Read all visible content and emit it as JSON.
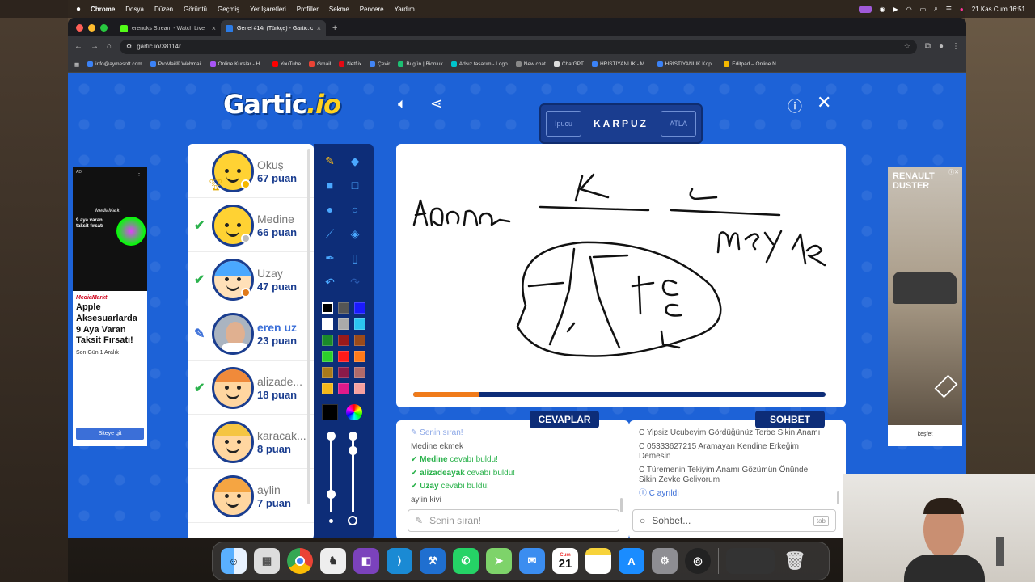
{
  "menubar": {
    "app": "Chrome",
    "items": [
      "Dosya",
      "Düzen",
      "Görüntü",
      "Geçmiş",
      "Yer İşaretleri",
      "Profiller",
      "Sekme",
      "Pencere",
      "Yardım"
    ],
    "clock": "21 Kas Cum  16:51"
  },
  "browser": {
    "tabs": [
      {
        "title": "erenuks Stream - Watch Live",
        "color": "#53fc18"
      },
      {
        "title": "Genel #14r (Türkçe) - Gartic.io",
        "color": "#2c7be5"
      }
    ],
    "url": "gartic.io/38114r",
    "bookmarks": [
      "info@aymesoft.com",
      "ProMail® Webmail",
      "Online Kurslar - H...",
      "YouTube",
      "Gmail",
      "Netflix",
      "Çevir",
      "Bugün | Bionluk",
      "Adsız tasarım - Logo",
      "New chat",
      "ChatGPT",
      "HRİSTİYANLIK - M...",
      "HRİSTİYANLIK Kop...",
      "Editpad – Online N..."
    ]
  },
  "game": {
    "logo_main": "Gartic",
    "logo_io": ".io",
    "hint_button": "İpucu",
    "word": "KARPUZ",
    "skip_button": "ATLA",
    "timer_fraction": 0.16,
    "players": [
      {
        "name": "Okuş",
        "score": "67 puan",
        "mark": "",
        "avatar_color": "#ffd233",
        "badge": "#f5b800"
      },
      {
        "name": "Medine",
        "score": "66 puan",
        "mark": "check",
        "avatar_color": "#ffd233",
        "badge": "#bbbbbb"
      },
      {
        "name": "Uzay",
        "score": "47 puan",
        "mark": "check",
        "avatar_color": "#4aa8ff",
        "badge": "#e07a1a"
      },
      {
        "name": "eren uz",
        "score": "23 puan",
        "mark": "pencil",
        "avatar_color": "#8899aa",
        "badge": ""
      },
      {
        "name": "alizade...",
        "score": "18 puan",
        "mark": "check",
        "avatar_color": "#f08a3a",
        "badge": ""
      },
      {
        "name": "karacak...",
        "score": "8 puan",
        "mark": "",
        "avatar_color": "#f5c542",
        "badge": ""
      },
      {
        "name": "aylin",
        "score": "7 puan",
        "mark": "",
        "avatar_color": "#f5a542",
        "badge": ""
      }
    ],
    "palette": [
      [
        "#000000",
        "#555555",
        "#1a1aff"
      ],
      [
        "#ffffff",
        "#aaaaaa",
        "#2bc4f0"
      ],
      [
        "#1a8a2a",
        "#9a1a1a",
        "#9a4a1a"
      ],
      [
        "#2bcf2b",
        "#ff1a1a",
        "#ff7a1a"
      ],
      [
        "#aa7a1a",
        "#8a1a4a",
        "#b06a6a"
      ],
      [
        "#f5b81a",
        "#e01a8a",
        "#f5a0a0"
      ]
    ],
    "answers_tab": "CEVAPLAR",
    "chat_tab": "SOHBET",
    "answers": [
      {
        "type": "turn",
        "text": "Senin sıran!"
      },
      {
        "type": "plain",
        "who": "Medine",
        "text": "ekmek"
      },
      {
        "type": "ok",
        "who": "Medine",
        "text": "cevabı buldu!"
      },
      {
        "type": "ok",
        "who": "alizadeayak",
        "text": "cevabı buldu!"
      },
      {
        "type": "ok",
        "who": "Uzay",
        "text": "cevabı buldu!"
      },
      {
        "type": "plain",
        "who": "aylin",
        "text": "kivi"
      }
    ],
    "answer_placeholder": "Senin sıran!",
    "chat": [
      {
        "text": "C Yipsiz Ucubeyim Gördüğünüz Terbe Sikin Anamı"
      },
      {
        "text": "C 05333627215 Aramayan Kendine Erkeğim Demesin"
      },
      {
        "text": "C Türemenin Tekiyim Anamı Gözümün Önünde Sikin Zevke Geliyorum"
      },
      {
        "text": "C ayrıldı",
        "info": true
      }
    ],
    "chat_placeholder": "Sohbet...",
    "chat_key": "tab"
  },
  "ads": {
    "left": {
      "label": "AD",
      "brand": "MediaMarkt",
      "headline": "Apple Aksesuarlarda 9 Aya Varan Taksit Fırsatı!",
      "sub": "Son Gün 1 Aralık",
      "button": "Siteye git",
      "promo": "9 aya varan taksit fırsatı"
    },
    "right": {
      "headline": "RENAULT DUSTER",
      "button": "keşfet"
    }
  },
  "dock": {
    "calendar_month": "Cum",
    "calendar_day": "21"
  }
}
